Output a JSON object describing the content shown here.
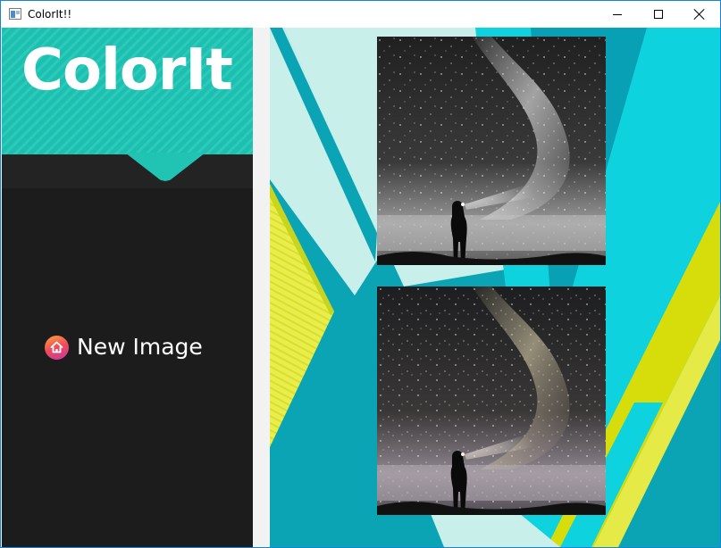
{
  "window": {
    "title": "ColorIt!!",
    "controls": {
      "minimize": "minimize",
      "maximize": "maximize",
      "close": "close"
    }
  },
  "sidebar": {
    "logo_text": "ColorIt",
    "new_image_label": "New Image",
    "new_image_icon": "home-icon"
  },
  "main": {
    "images": [
      {
        "name": "original-image",
        "style": "grayscale",
        "content": "silhouette with headlamp under milky way"
      },
      {
        "name": "colorized-image",
        "style": "colorized",
        "content": "silhouette with headlamp under milky way"
      }
    ]
  },
  "colors": {
    "accent_teal": "#1bc0b0",
    "sidebar_bg": "#1c1c1c",
    "canvas_cyan": "#0ed2dd",
    "canvas_teal": "#0aa4b5",
    "canvas_pale": "#c8efea",
    "canvas_yellow": "#d7dc0b",
    "canvas_lime": "#e8ec46"
  }
}
